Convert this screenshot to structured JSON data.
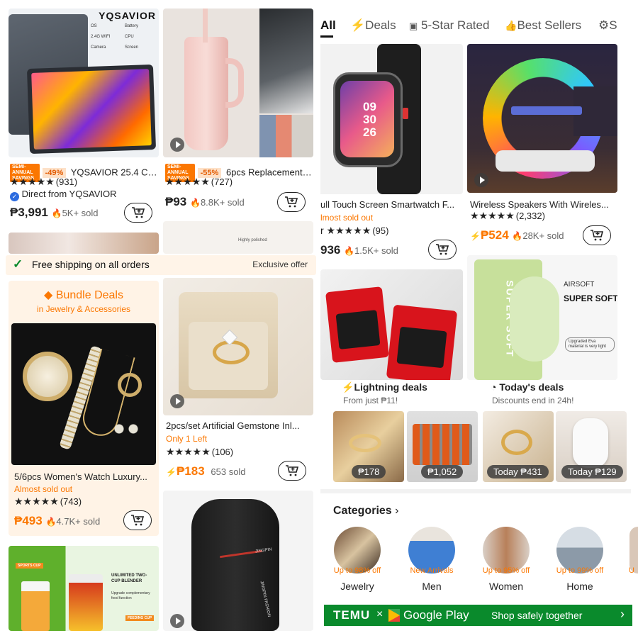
{
  "tabs": [
    {
      "label": "All",
      "icon": "none"
    },
    {
      "label": "Deals",
      "icon": "lightning-icon"
    },
    {
      "label": "5-Star Rated",
      "icon": "star-badge-icon"
    },
    {
      "label": "Best Sellers",
      "icon": "thumbs-up-icon"
    },
    {
      "label": "S",
      "icon": "gear-icon"
    }
  ],
  "products": {
    "tablet": {
      "brand_banner": "YQSAVIOR",
      "spec_labels": [
        "OS",
        "Battery",
        "2.4G WIFI",
        "CPU",
        "Camera",
        "Screen"
      ],
      "sale_badge": "SEMI-ANNUAL SAVINGS",
      "discount": "-49%",
      "title": "YQSAVIOR 25.4 Cm...",
      "stars": "★★★★★",
      "reviews": "(931)",
      "seller": "Direct from YQSAVIOR",
      "price": "₱3,991",
      "sold": "5K+ sold"
    },
    "tumbler": {
      "sale_badge": "SEMI-ANNUAL SAVINGS",
      "discount": "-55%",
      "title": "6pcs Replacement ...",
      "stars": "★★★★★",
      "reviews": "(727)",
      "price": "₱93",
      "sold": "8.8K+ sold"
    },
    "smartwatch": {
      "screen_time": "09\n30\n26",
      "title": "ull Touch Screen Smartwatch F...",
      "status": "lmost sold out",
      "stars": "r ★★★★★",
      "reviews": "(95)",
      "price": "936",
      "sold": "1.5K+ sold"
    },
    "speaker": {
      "title": "Wireless Speakers With Wireles...",
      "stars": "★★★★★",
      "reviews": "(2,332)",
      "price": "₱524",
      "sold": "28K+ sold"
    },
    "ring": {
      "caption": "Highly polished",
      "title": "2pcs/set Artificial Gemstone Inl...",
      "status": "Only 1 Left",
      "stars": "★★★★★",
      "reviews": "(106)",
      "price": "₱183",
      "sold": "653 sold"
    },
    "watchset": {
      "title": "5/6pcs Women's Watch Luxury...",
      "status": "Almost sold out",
      "stars": "★★★★★",
      "reviews": "(743)",
      "price": "₱493",
      "sold": "4.7K+ sold"
    },
    "slippers": {
      "brand": "AIRSOFT",
      "headline": "SUPER SOFT",
      "vertical": "SUPER SOFT",
      "note": "Upgraded Eva material is very light"
    },
    "blender": {
      "tag": "SPORTS CUP",
      "headline": "UNLIMITED TWO-CUP BLENDER",
      "sub": "Upgrade complementary food function",
      "tag2": "FEEDING CUP"
    },
    "backpack": {
      "logo": "JINGPIN",
      "strap_text": "JINGPIN FASHION"
    }
  },
  "shipping_bar": {
    "label": "Free shipping on all orders",
    "offer": "Exclusive offer"
  },
  "bundle": {
    "title": "Bundle Deals",
    "subtitle": "in Jewelry & Accessories"
  },
  "lightning": {
    "title": "Lightning deals",
    "sub": "From just ₱11!",
    "prices": [
      "₱178",
      "₱1,052"
    ]
  },
  "today": {
    "title": "Today's deals",
    "sub": "Discounts end in 24h!",
    "prices": [
      "Today ₱431",
      "Today ₱129"
    ]
  },
  "categories": {
    "title": "Categories",
    "items": [
      {
        "discount": "Up to 98% off",
        "name": "Jewelry"
      },
      {
        "discount": "New Arrivals",
        "name": "Men"
      },
      {
        "discount": "Up to 95% off",
        "name": "Women"
      },
      {
        "discount": "Up to 99% off",
        "name": "Home"
      },
      {
        "discount": "U",
        "name": ""
      }
    ]
  },
  "banner": {
    "brand": "TEMU",
    "times": "×",
    "store": "Google Play",
    "tagline": "Shop safely together"
  },
  "colors": {
    "accent": "#fb7701",
    "banner_green": "#0a8a2c"
  }
}
